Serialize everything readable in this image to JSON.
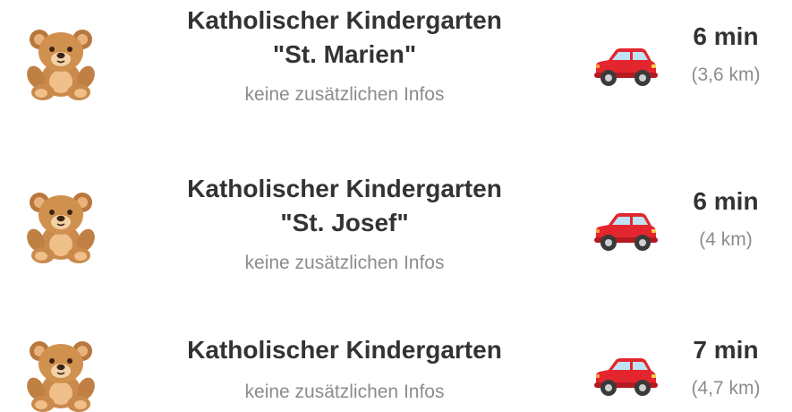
{
  "kindergartens": [
    {
      "title": "Katholischer Kindergarten \"St. Marien\"",
      "info": "keine zusätzlichen Infos",
      "duration": "6 min",
      "distance": "(3,6 km)",
      "place_icon": "teddy-bear-icon",
      "transport_icon": "car-icon"
    },
    {
      "title": "Katholischer Kindergarten \"St. Josef\"",
      "info": "keine zusätzlichen Infos",
      "duration": "6 min",
      "distance": "(4 km)",
      "place_icon": "teddy-bear-icon",
      "transport_icon": "car-icon"
    },
    {
      "title": "Katholischer Kindergarten",
      "info": "keine zusätzlichen Infos",
      "duration": "7 min",
      "distance": "(4,7 km)",
      "place_icon": "teddy-bear-icon",
      "transport_icon": "car-icon"
    }
  ],
  "colors": {
    "title_text": "#333333",
    "secondary_text": "#8c8c8c",
    "bear_fur": "#c98a4b",
    "bear_light": "#f0c08a",
    "car_body": "#e3262e",
    "background": "#ffffff"
  }
}
